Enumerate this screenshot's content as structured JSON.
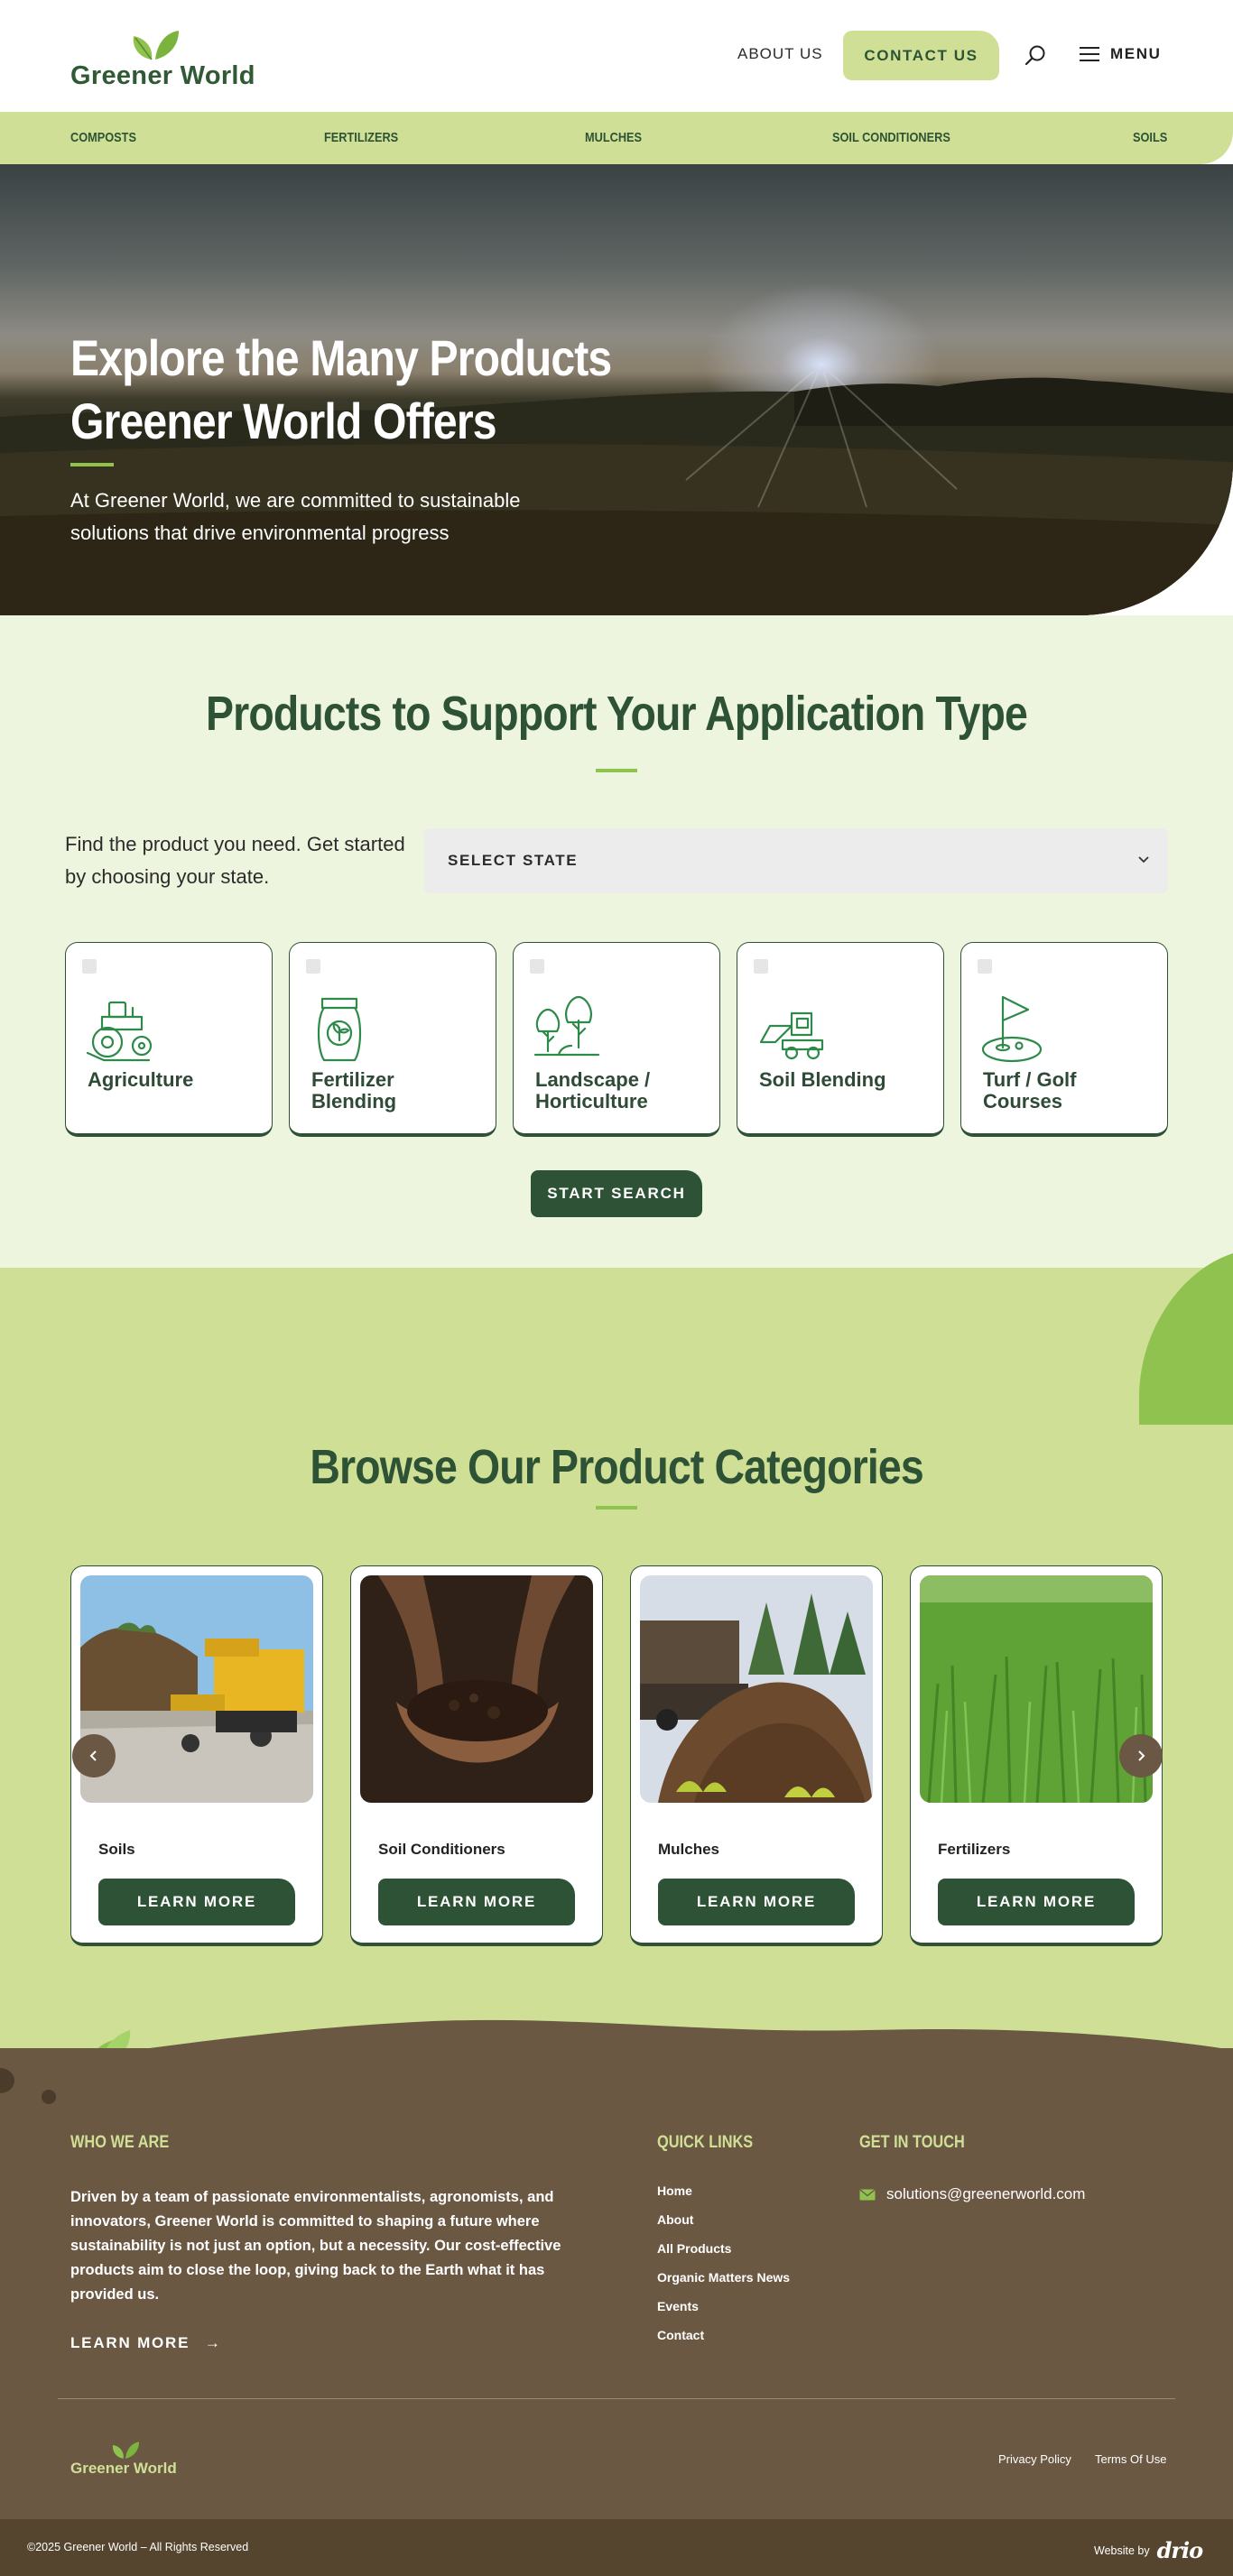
{
  "brand": {
    "name": "Greener World"
  },
  "header": {
    "about": "ABOUT US",
    "contact": "CONTACT US",
    "menu": "MENU"
  },
  "categories_bar": [
    "COMPOSTS",
    "FERTILIZERS",
    "MULCHES",
    "SOIL CONDITIONERS",
    "SOILS"
  ],
  "hero": {
    "title": "Explore the Many Products Greener World Offers",
    "subtitle": "At Greener World, we are committed to sustainable solutions that drive environmental progress"
  },
  "products": {
    "title": "Products to Support Your Application Type",
    "find_text": "Find the product you need. Get started by choosing your state.",
    "select_state": "SELECT STATE",
    "application_types": [
      {
        "label": "Agriculture",
        "icon": "tractor-icon"
      },
      {
        "label": "Fertilizer Blending",
        "icon": "fertilizer-bag-icon"
      },
      {
        "label": "Landscape / Horticulture",
        "icon": "trees-icon"
      },
      {
        "label": "Soil Blending",
        "icon": "skid-steer-icon"
      },
      {
        "label": "Turf / Golf Courses",
        "icon": "golf-flag-icon"
      }
    ],
    "start_search": "START SEARCH"
  },
  "browse": {
    "title": "Browse Our Product Categories",
    "cards": [
      {
        "name": "Soils",
        "button": "LEARN MORE"
      },
      {
        "name": "Soil Conditioners",
        "button": "LEARN MORE"
      },
      {
        "name": "Mulches",
        "button": "LEARN MORE"
      },
      {
        "name": "Fertilizers",
        "button": "LEARN MORE"
      }
    ]
  },
  "footer": {
    "who_title": "WHO WE ARE",
    "who_text": "Driven by a team of passionate environmentalists, agronomists, and innovators, Greener World is committed to shaping a future where sustainability is not just an option, but a necessity. Our cost-effective products aim to close the loop, giving back to the Earth what it has provided us.",
    "learn_more": "LEARN MORE",
    "quick_title": "QUICK LINKS",
    "quick_links": [
      "Home",
      "About",
      "All Products",
      "Organic Matters News",
      "Events",
      "Contact"
    ],
    "touch_title": "GET IN TOUCH",
    "email": "solutions@greenerworld.com",
    "privacy": "Privacy Policy",
    "terms": "Terms Of Use",
    "copyright": "©2025   Greener World – All Rights Reserved",
    "website_by": "Website by",
    "agency": "drio"
  },
  "colors": {
    "dark_green": "#2d5235",
    "light_green": "#cfe096",
    "pale_green": "#eef5de",
    "accent_green": "#8fc24f",
    "brown": "#6b5843"
  }
}
